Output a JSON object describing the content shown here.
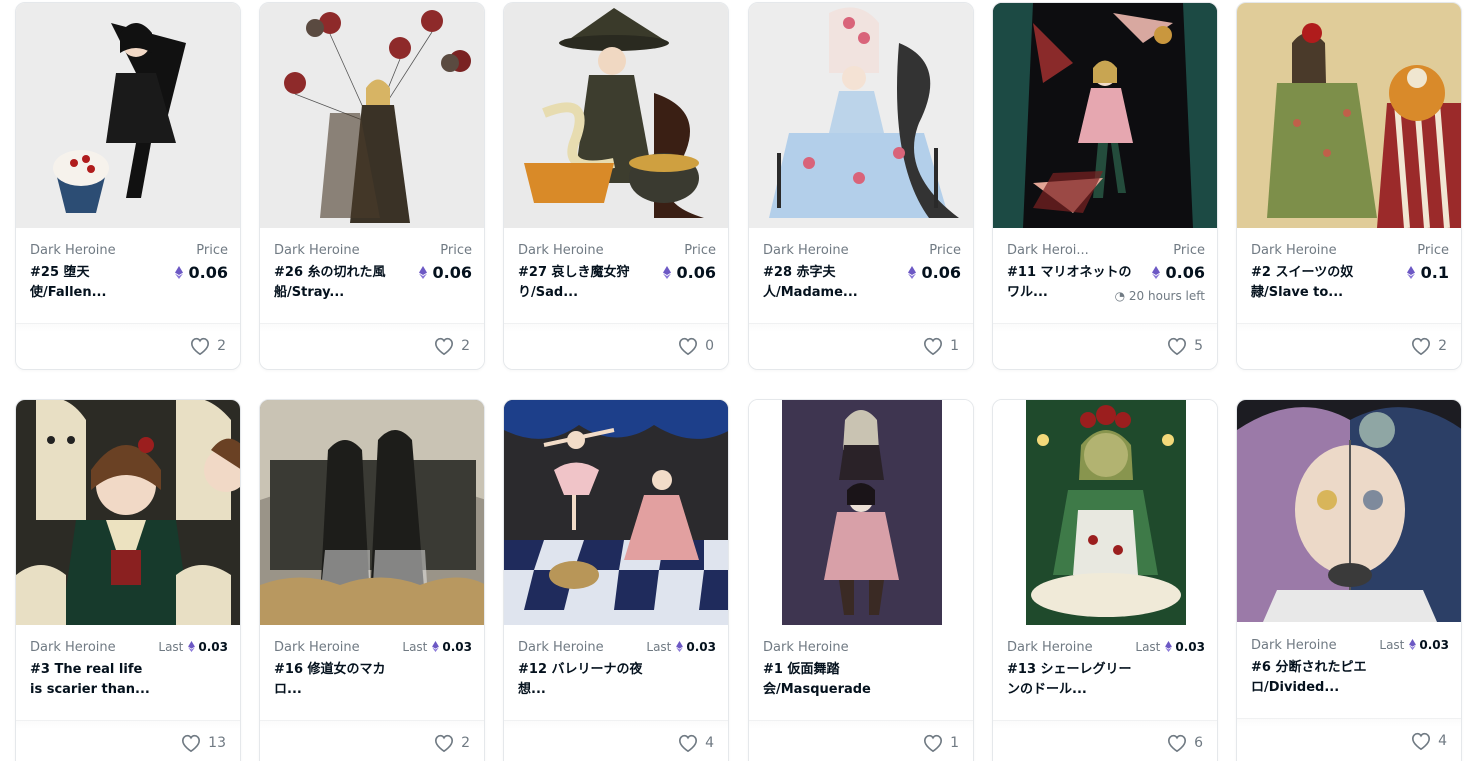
{
  "labels": {
    "price": "Price",
    "last": "Last"
  },
  "colors": {
    "eth": "#6c58c4",
    "text": "#04111d",
    "muted": "#707a83"
  },
  "cards": [
    {
      "collection": "Dark Heroine",
      "name": "#25 堕天使/Fallen...",
      "price": "0.06",
      "likes": "2"
    },
    {
      "collection": "Dark Heroine",
      "name": "#26 糸の切れた風船/Stray...",
      "price": "0.06",
      "likes": "2"
    },
    {
      "collection": "Dark Heroine",
      "name": "#27 哀しき魔女狩り/Sad...",
      "price": "0.06",
      "likes": "0"
    },
    {
      "collection": "Dark Heroine",
      "name": "#28 赤字夫人/Madame...",
      "price": "0.06",
      "likes": "1"
    },
    {
      "collection": "Dark Heroi...",
      "name": "#11 マリオネットのワル...",
      "price": "0.06",
      "time_left": "20 hours left",
      "likes": "5"
    },
    {
      "collection": "Dark Heroine",
      "name": "#2 スイーツの奴隷/Slave to...",
      "price": "0.1",
      "likes": "2"
    },
    {
      "collection": "Dark Heroine",
      "name": "#3 The real life is scarier than...",
      "last": "0.03",
      "likes": "13"
    },
    {
      "collection": "Dark Heroine",
      "name": "#16 修道女のマカロ...",
      "last": "0.03",
      "likes": "2"
    },
    {
      "collection": "Dark Heroine",
      "name": "#12 バレリーナの夜想...",
      "last": "0.03",
      "likes": "4"
    },
    {
      "collection": "Dark Heroine",
      "name": "#1 仮面舞踏会/Masquerade",
      "likes": "1"
    },
    {
      "collection": "Dark Heroine",
      "name": "#13 シェーレグリーンのドール...",
      "last": "0.03",
      "likes": "6"
    },
    {
      "collection": "Dark Heroine",
      "name": "#6 分断されたピエロ/Divided...",
      "last": "0.03",
      "likes": "4"
    }
  ]
}
